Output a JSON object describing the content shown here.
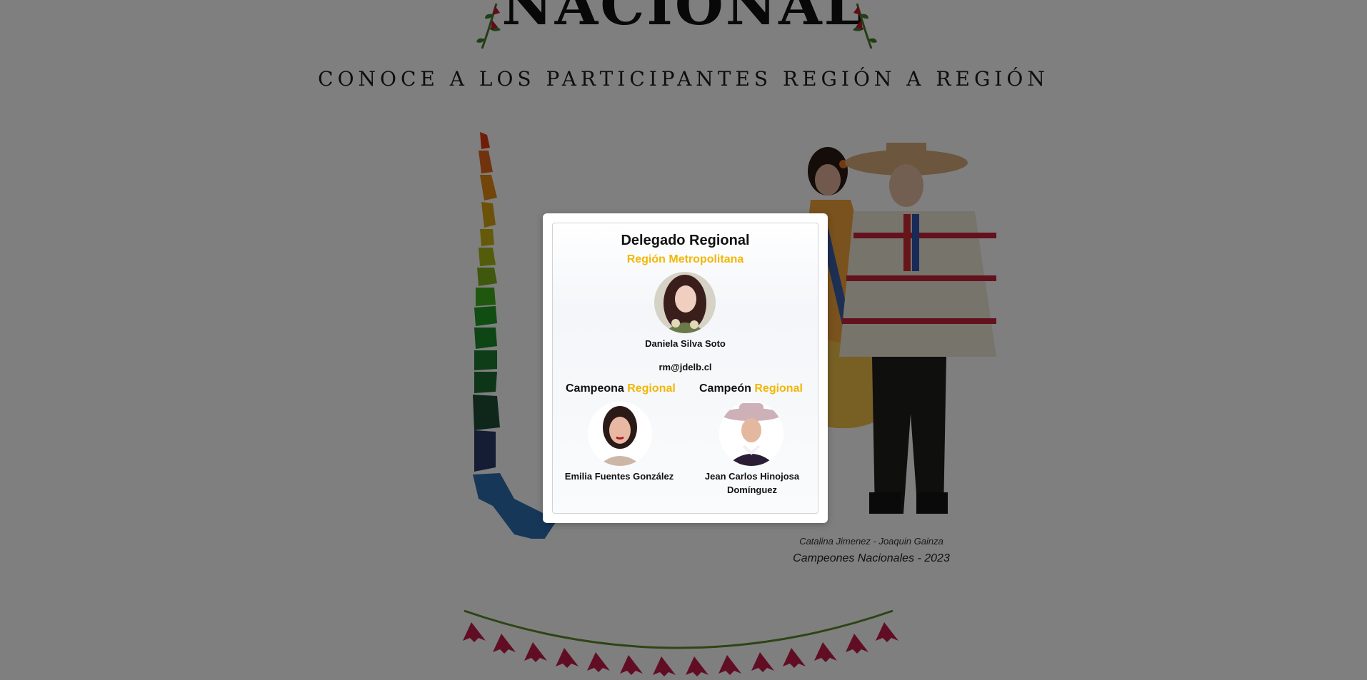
{
  "page": {
    "title": "NACIONAL",
    "subtitle": "CONOCE A LOS PARTICIPANTES REGIÓN A REGIÓN",
    "credit_names": "Catalina Jimenez - Joaquin Gainza",
    "credit_title": "Campeones Nacionales - 2023"
  },
  "modal": {
    "title": "Delegado Regional",
    "region": "Región Metropolitana",
    "delegate": {
      "name": "Daniela Silva Soto",
      "email": "rm@jdelb.cl"
    },
    "champion_female": {
      "heading_word": "Campeona",
      "heading_accent": "Regional",
      "name": "Emilia Fuentes González"
    },
    "champion_male": {
      "heading_word": "Campeón",
      "heading_accent": "Regional",
      "name": "Jean Carlos Hinojosa Domínguez"
    }
  },
  "colors": {
    "accent": "#f2b705",
    "overlay": "rgba(0,0,0,0.5)"
  }
}
